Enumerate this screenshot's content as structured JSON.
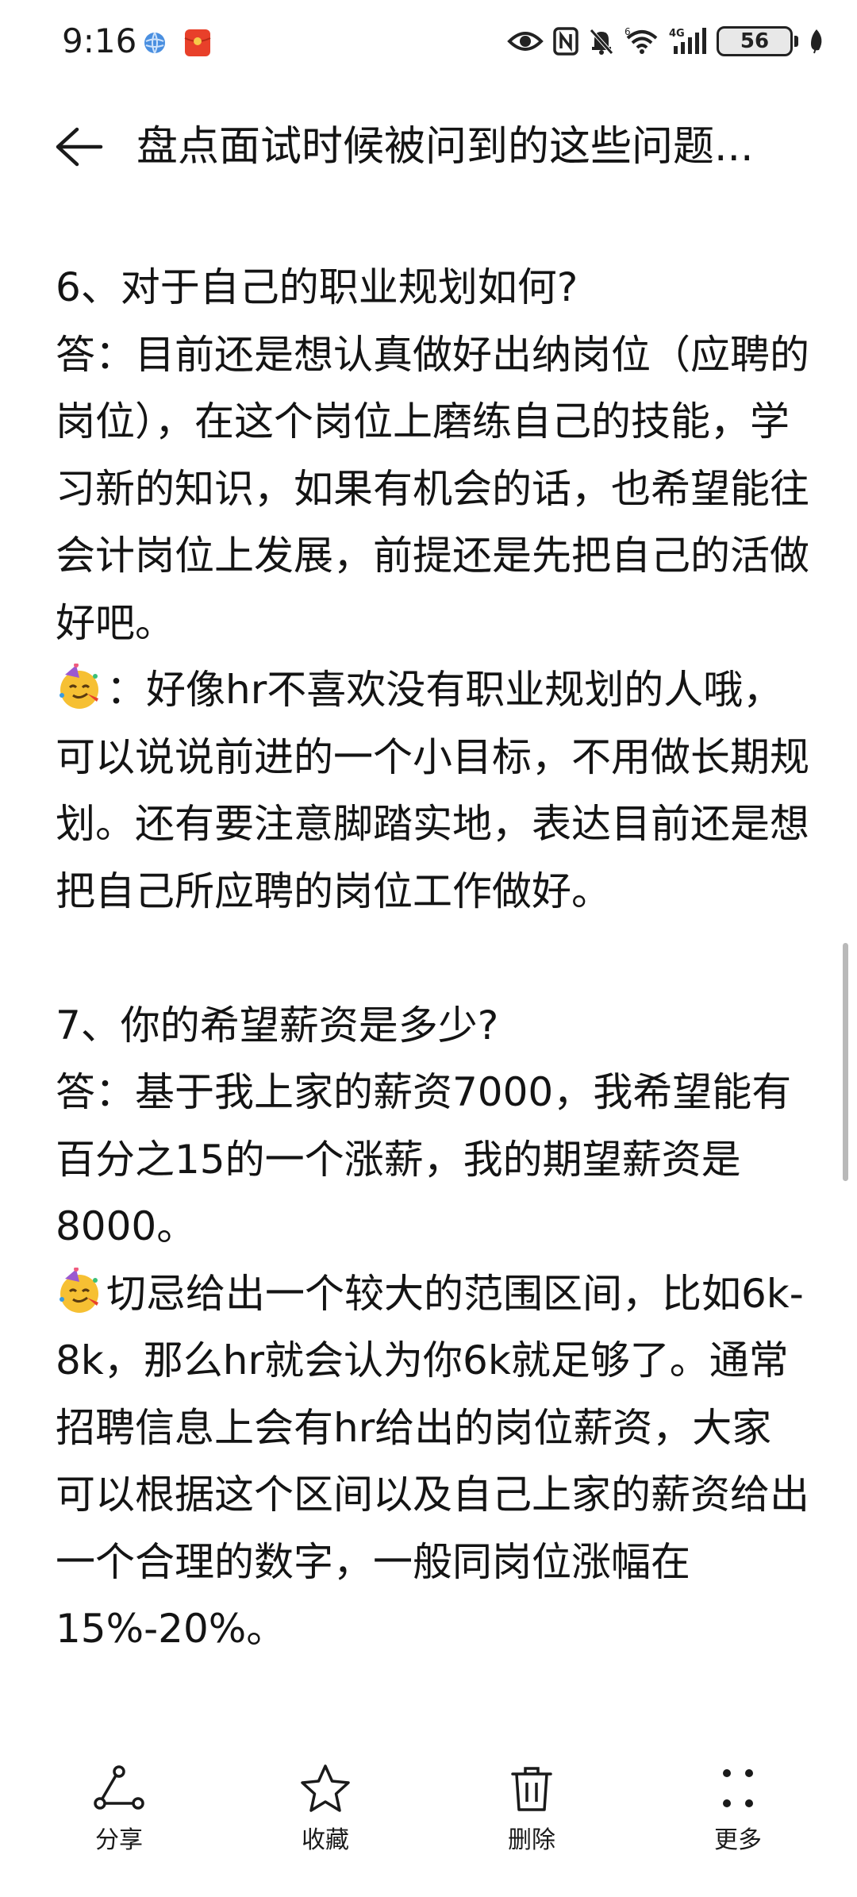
{
  "status_bar": {
    "time": "9:16",
    "battery": "56",
    "network": "4G",
    "wifi_badge": "6"
  },
  "header": {
    "title": "盘点面试时候被问到的这些问题..."
  },
  "article": {
    "paragraphs": [
      "6、对于自己的职业规划如何?",
      "答：目前还是想认真做好出纳岗位（应聘的岗位），在这个岗位上磨练自己的技能，学习新的知识，如果有机会的话，也希望能往会计岗位上发展，前提还是先把自己的活做好吧。",
      "：好像hr不喜欢没有职业规划的人哦，可以说说前进的一个小目标，不用做长期规划。还有要注意脚踏实地，表达目前还是想把自己所应聘的岗位工作做好。",
      "7、你的希望薪资是多少?",
      "答：基于我上家的薪资7000，我希望能有百分之15的一个涨薪，我的期望薪资是8000。",
      "切忌给出一个较大的范围区间，比如6k-8k，那么hr就会认为你6k就足够了。通常招聘信息上会有hr给出的岗位薪资，大家可以根据这个区间以及自己上家的薪资给出一个合理的数字，一般同岗位涨幅在15%-20%。"
    ]
  },
  "toolbar": {
    "share": "分享",
    "favorite": "收藏",
    "delete": "删除",
    "more": "更多"
  },
  "icons": {
    "back": "arrow-left-icon",
    "share": "share-icon",
    "favorite": "star-icon",
    "delete": "trash-icon",
    "more": "dots-icon",
    "emoji": "party-face-emoji-icon"
  },
  "colors": {
    "text": "#141414",
    "background": "#ffffff",
    "emoji_yellow": "#f6c033"
  }
}
